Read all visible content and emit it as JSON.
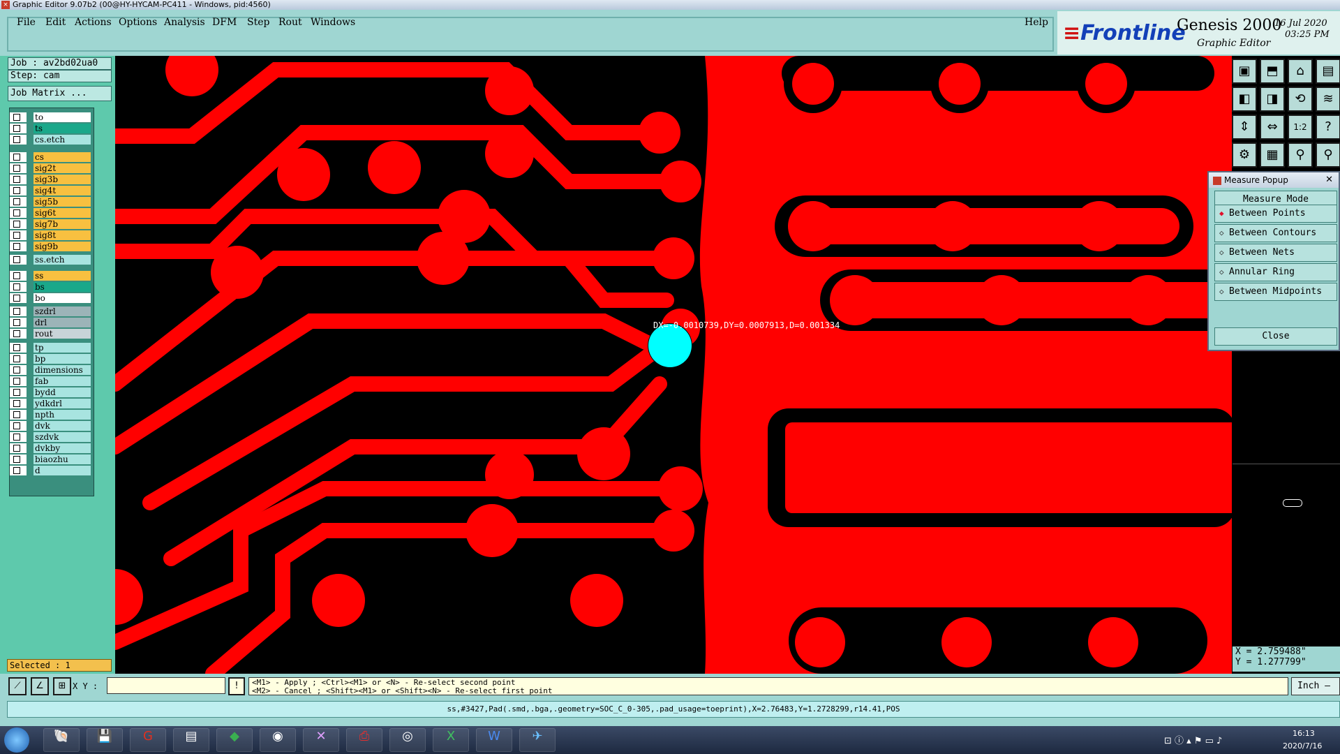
{
  "window": {
    "title": "Graphic Editor 9.07b2 (00@HY-HYCAM-PC411 - Windows, pid:4560)"
  },
  "menu": {
    "items": [
      "File",
      "Edit",
      "Actions",
      "Options",
      "Analysis",
      "DFM",
      "Step",
      "Rout",
      "Windows"
    ],
    "help": "Help"
  },
  "brand": {
    "logo": "Frontline",
    "product": "Genesis 2000",
    "subtitle": "Graphic Editor",
    "date": "16 Jul 2020",
    "time": "03:25 PM"
  },
  "job": {
    "job": "Job : av2bd02ua0",
    "step": "Step: cam",
    "matrix": "Job Matrix ..."
  },
  "layers": [
    {
      "name": "to",
      "color": "#ffffff"
    },
    {
      "name": "ts",
      "color": "#1aa88a"
    },
    {
      "name": "cs.etch",
      "color": "#a8e4e0"
    },
    {
      "name": "cs",
      "color": "#f8c040"
    },
    {
      "name": "sig2t",
      "color": "#f8c040"
    },
    {
      "name": "sig3b",
      "color": "#f8c040"
    },
    {
      "name": "sig4t",
      "color": "#f8c040"
    },
    {
      "name": "sig5b",
      "color": "#f8c040"
    },
    {
      "name": "sig6t",
      "color": "#f8c040"
    },
    {
      "name": "sig7b",
      "color": "#f8c040"
    },
    {
      "name": "sig8t",
      "color": "#f8c040"
    },
    {
      "name": "sig9b",
      "color": "#f8c040"
    },
    {
      "name": "ss.etch",
      "color": "#a8e4e0"
    },
    {
      "name": "ss",
      "color": "#f8c040"
    },
    {
      "name": "bs",
      "color": "#1aa88a"
    },
    {
      "name": "bo",
      "color": "#ffffff"
    },
    {
      "name": "szdrl",
      "color": "#9cb4b8"
    },
    {
      "name": "drl",
      "color": "#9cb4b8"
    },
    {
      "name": "rout",
      "color": "#c8d4d8"
    },
    {
      "name": "tp",
      "color": "#a8e4e0"
    },
    {
      "name": "bp",
      "color": "#a8e4e0"
    },
    {
      "name": "dimensions",
      "color": "#a8e4e0"
    },
    {
      "name": "fab",
      "color": "#a8e4e0"
    },
    {
      "name": "bydd",
      "color": "#a8e4e0"
    },
    {
      "name": "ydkdrl",
      "color": "#a8e4e0"
    },
    {
      "name": "npth",
      "color": "#a8e4e0"
    },
    {
      "name": "dvk",
      "color": "#a8e4e0"
    },
    {
      "name": "szdvk",
      "color": "#a8e4e0"
    },
    {
      "name": "dvkby",
      "color": "#a8e4e0"
    },
    {
      "name": "biaozhu",
      "color": "#a8e4e0"
    },
    {
      "name": "d",
      "color": "#a8e4e0"
    }
  ],
  "selected": "Selected : 1",
  "measure_readout": "DX=-0.0010739,DY=0.0007913,D=0.001334",
  "popup": {
    "title": "Measure Popup",
    "header": "Measure Mode",
    "options": [
      "Between Points",
      "Between Contours",
      "Between Nets",
      "Annular Ring",
      "Between Midpoints"
    ],
    "close": "Close"
  },
  "coords": {
    "x": "X = 2.759488\"",
    "y": "Y = 1.277799\""
  },
  "xy_label": "X Y :",
  "prompt": {
    "line1": "<M1> - Apply  ; <Ctrl><M1> or <N> - Re-select second point",
    "line2": "<M2> - Cancel ; <Shift><M1> or <Shift><N> - Re-select first point"
  },
  "units": "Inch",
  "status": "ss,#3427,Pad(.smd,.bga,.geometry=SOC_C_0-305,.pad_usage=toeprint),X=2.76483,Y=1.2728299,r14.41,POS",
  "taskbar": {
    "time": "16:13",
    "date": "2020/7/16"
  },
  "colors": {
    "copper": "#ff0000",
    "clearance": "#000000",
    "highlight": "#00ffff"
  }
}
